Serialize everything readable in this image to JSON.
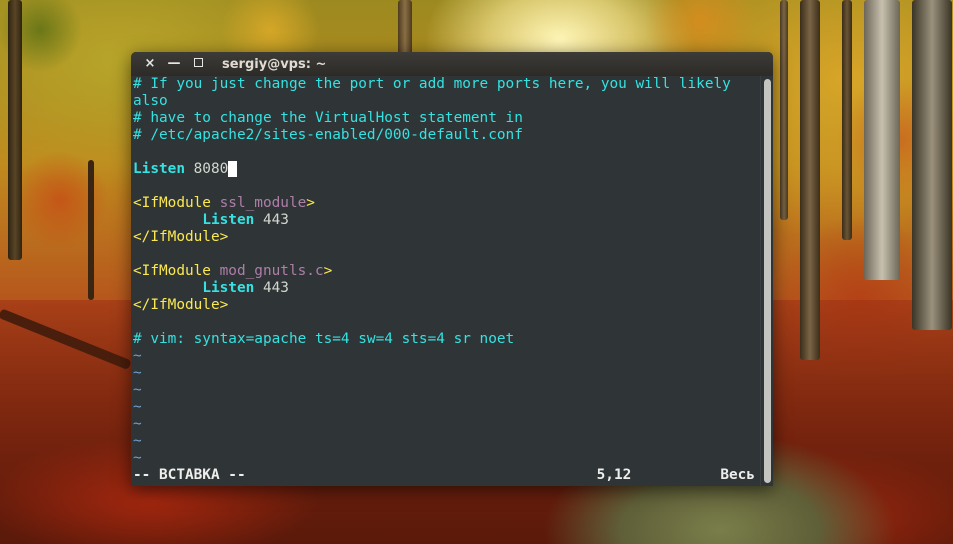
{
  "window": {
    "title": "sergiy@vps: ~",
    "close_glyph": "×",
    "minimize_glyph": "—"
  },
  "editor": {
    "lines": [
      {
        "kind": "comment",
        "text": "# If you just change the port or add more ports here, you will likely"
      },
      {
        "kind": "comment",
        "text": "also"
      },
      {
        "kind": "comment",
        "text": "# have to change the VirtualHost statement in"
      },
      {
        "kind": "comment",
        "text": "# /etc/apache2/sites-enabled/000-default.conf"
      },
      {
        "kind": "blank"
      },
      {
        "kind": "listen",
        "indent": "",
        "keyword": "Listen",
        "value": " 8080",
        "cursor": true
      },
      {
        "kind": "blank"
      },
      {
        "kind": "open",
        "open": "<IfModule",
        "arg": " ssl_module",
        "close": ">"
      },
      {
        "kind": "listen",
        "indent": "        ",
        "keyword": "Listen",
        "value": " 443"
      },
      {
        "kind": "closetag",
        "text": "</IfModule>"
      },
      {
        "kind": "blank"
      },
      {
        "kind": "open",
        "open": "<IfModule",
        "arg": " mod_gnutls.c",
        "close": ">"
      },
      {
        "kind": "listen",
        "indent": "        ",
        "keyword": "Listen",
        "value": " 443"
      },
      {
        "kind": "closetag",
        "text": "</IfModule>"
      },
      {
        "kind": "blank"
      },
      {
        "kind": "comment",
        "text": "# vim: syntax=apache ts=4 sw=4 sts=4 sr noet"
      },
      {
        "kind": "tilde",
        "text": "~"
      },
      {
        "kind": "tilde",
        "text": "~"
      },
      {
        "kind": "tilde",
        "text": "~"
      },
      {
        "kind": "tilde",
        "text": "~"
      },
      {
        "kind": "tilde",
        "text": "~"
      },
      {
        "kind": "tilde",
        "text": "~"
      },
      {
        "kind": "tilde",
        "text": "~"
      }
    ],
    "status": {
      "mode": "-- ВСТАВКА --",
      "position": "5,12",
      "scroll": "Весь"
    }
  },
  "colors": {
    "terminal_bg": "#2f3436",
    "comment": "#34e2e2",
    "tag": "#fce94f",
    "argument": "#ad7fa8",
    "tilde": "#729fcf"
  }
}
